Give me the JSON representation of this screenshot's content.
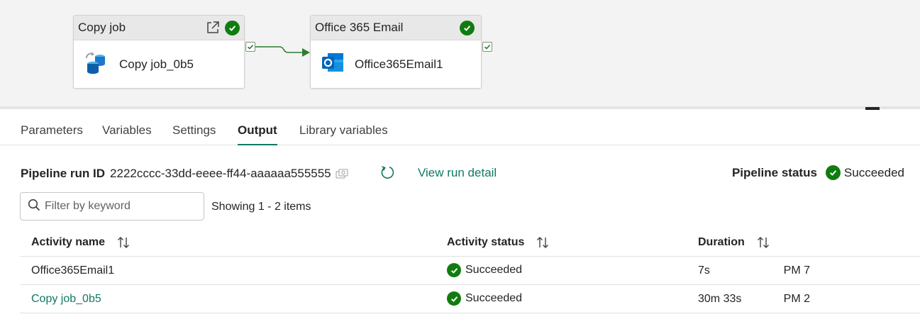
{
  "canvas": {
    "nodes": [
      {
        "title": "Copy job",
        "label": "Copy job_0b5",
        "status_icon": "check-circle-icon"
      },
      {
        "title": "Office 365 Email",
        "label": "Office365Email1",
        "status_icon": "check-circle-icon"
      }
    ]
  },
  "tabs": [
    {
      "label": "Parameters"
    },
    {
      "label": "Variables"
    },
    {
      "label": "Settings"
    },
    {
      "label": "Output",
      "active": true
    },
    {
      "label": "Library variables"
    }
  ],
  "run": {
    "id_label": "Pipeline run ID",
    "id_value": "2222cccc-33dd-eeee-ff44-aaaaaa555555",
    "view_detail": "View run detail",
    "status_label": "Pipeline status",
    "status_value": "Succeeded"
  },
  "filter": {
    "placeholder": "Filter by keyword",
    "showing": "Showing 1 - 2 items"
  },
  "table": {
    "columns": [
      "Activity name",
      "Activity status",
      "Duration"
    ],
    "rows": [
      {
        "name": "Office365Email1",
        "status": "Succeeded",
        "duration": "7s",
        "extra": "7 PM"
      },
      {
        "name": "Copy job_0b5",
        "status": "Succeeded",
        "duration": "30m 33s",
        "extra": "2 PM"
      }
    ]
  },
  "colors": {
    "accent": "#117865",
    "success": "#107c10",
    "canvas_bg": "#f3f3f3"
  }
}
